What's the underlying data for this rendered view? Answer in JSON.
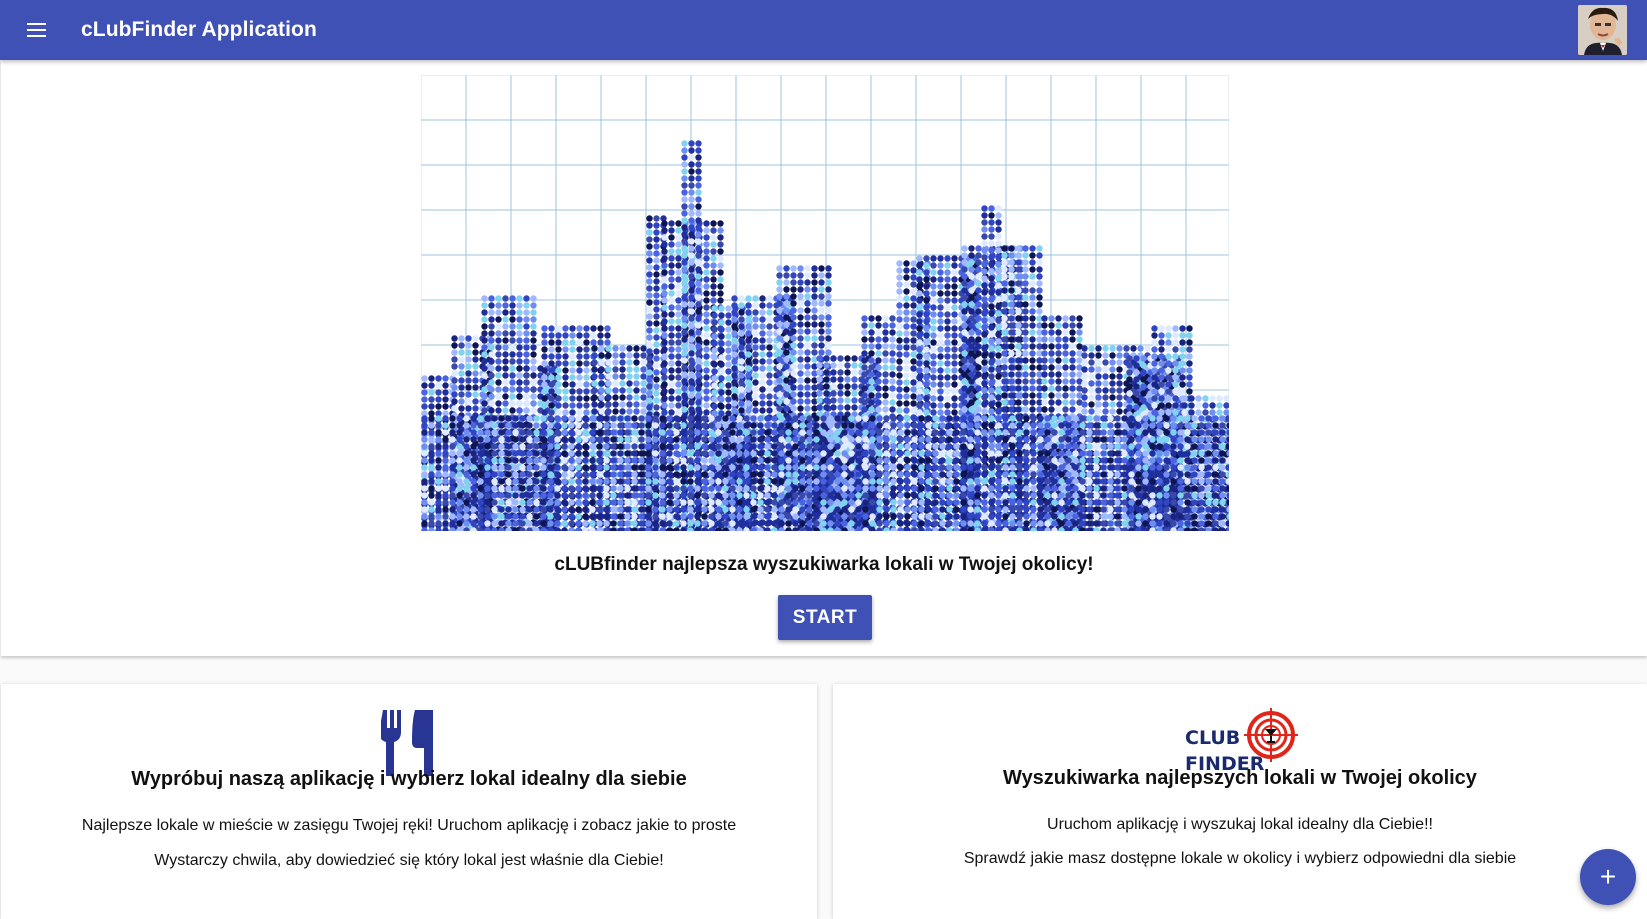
{
  "appbar": {
    "title": "cLubFinder Application",
    "menu_icon": "menu-icon",
    "avatar_icon": "user-avatar"
  },
  "hero": {
    "image_icon": "city-skyline-illustration",
    "tagline": "cLUBfinder najlepsza wyszukiwarka lokali w Twojej okolicy!",
    "start_label": "START"
  },
  "cards": [
    {
      "icon": "fork-knife-icon",
      "title": "Wypróbuj naszą aplikację i wybierz lokal idealny dla siebie",
      "lines": [
        "Najlepsze lokale w mieście w zasięgu Twojej ręki! Uruchom aplikację i zobacz jakie to proste",
        "Wystarczy chwila, aby dowiedzieć się który lokal jest właśnie dla Ciebie!"
      ]
    },
    {
      "icon": "club-finder-logo",
      "logo_text": [
        "CLUB",
        "FINDER"
      ],
      "title": "Wyszukiwarka najlepszych lokali w Twojej okolicy",
      "lines": [
        "Uruchom aplikację i wyszukaj lokal idealny dla Ciebie!!",
        "Sprawdź jakie masz dostępne lokale w okolicy i wybierz odpowiedni dla siebie"
      ]
    }
  ],
  "fab": {
    "label": "+",
    "icon": "plus-icon"
  },
  "colors": {
    "primary": "#3f51b5",
    "logo_red": "#e0251b",
    "logo_navy": "#1a2a6c"
  }
}
